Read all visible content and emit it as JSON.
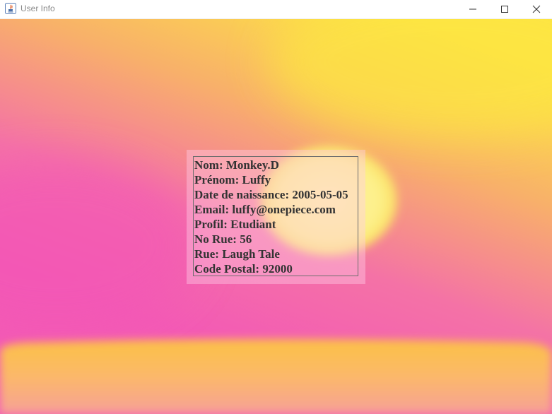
{
  "window": {
    "title": "User Info",
    "controls": {
      "minimize_icon": "minimize-icon",
      "maximize_icon": "maximize-icon",
      "close_icon": "close-icon"
    }
  },
  "colors": {
    "bg_yellow": "#fde242",
    "bg_pink": "#f35cb6",
    "bg_orange": "#f59e78",
    "panel_text": "#333333"
  },
  "user_info": {
    "lines": [
      "Nom: Monkey.D",
      "Prénom: Luffy",
      "Date de naissance: 2005-05-05",
      "Email: luffy@onepiece.com",
      "Profil: Etudiant",
      "No Rue: 56",
      "Rue: Laugh Tale",
      "Code Postal: 92000"
    ]
  }
}
